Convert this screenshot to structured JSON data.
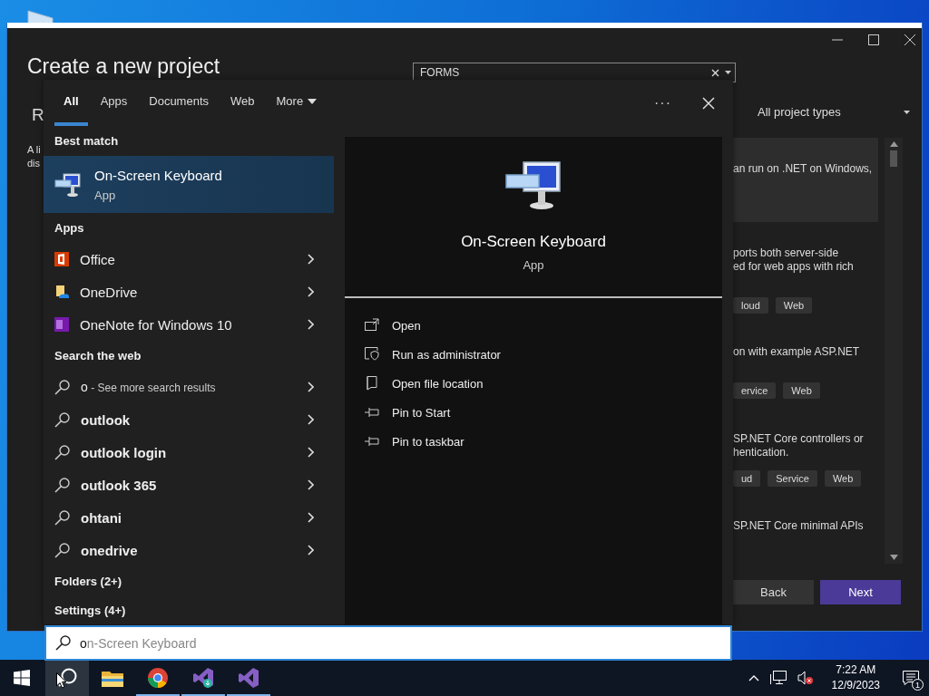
{
  "vs_window": {
    "title": "Create a new project",
    "search": {
      "value": "FORMS"
    },
    "recent_heading": "R",
    "description_lines": [
      "A li",
      "dis"
    ],
    "filter": "All project types",
    "templates": [
      {
        "selected": true,
        "lines": [
          "an run on .NET on Windows,"
        ]
      },
      {
        "selected": false,
        "lines": [
          "ports both server-side",
          "ed for web apps with rich"
        ],
        "tags": [
          "loud",
          "Web"
        ]
      },
      {
        "selected": false,
        "lines": [
          "on with example ASP.NET"
        ],
        "tags": [
          "ervice",
          "Web"
        ]
      },
      {
        "selected": false,
        "lines": [
          "SP.NET Core controllers or",
          "hentication."
        ],
        "tags": [
          "ud",
          "Service",
          "Web"
        ]
      },
      {
        "selected": false,
        "lines": [
          "SP.NET Core minimal APIs"
        ]
      }
    ],
    "buttons": [
      {
        "label": "Back",
        "kind": "secondary"
      },
      {
        "label": "Next",
        "kind": "primary"
      }
    ]
  },
  "search_panel": {
    "tabs": [
      {
        "label": "All",
        "selected": true,
        "dropdown": false
      },
      {
        "label": "Apps",
        "selected": false,
        "dropdown": false
      },
      {
        "label": "Documents",
        "selected": false,
        "dropdown": false
      },
      {
        "label": "Web",
        "selected": false,
        "dropdown": false
      },
      {
        "label": "More",
        "selected": false,
        "dropdown": true
      }
    ],
    "more_options": "···",
    "best_match": {
      "heading": "Best match",
      "title": "On-Screen Keyboard",
      "subtitle": "App",
      "selected": true
    },
    "apps": {
      "heading": "Apps",
      "items": [
        "Office",
        "OneDrive",
        "OneNote for Windows 10"
      ]
    },
    "web": {
      "heading": "Search the web",
      "items": [
        {
          "query": "o",
          "suffix": " - See more search results"
        },
        {
          "query": "outlook"
        },
        {
          "query": "outlook login"
        },
        {
          "query": "outlook 365"
        },
        {
          "query": "ohtani"
        },
        {
          "query": "onedrive"
        }
      ]
    },
    "groups": [
      "Folders (2+)",
      "Settings (4+)"
    ],
    "preview": {
      "title": "On-Screen Keyboard",
      "subtitle": "App",
      "actions": [
        "Open",
        "Run as administrator",
        "Open file location",
        "Pin to Start",
        "Pin to taskbar"
      ]
    },
    "search_box": {
      "value": "o",
      "completion": "n-Screen Keyboard"
    }
  },
  "taskbar": {
    "buttons": [
      {
        "selected": false,
        "running": false
      },
      {
        "selected": true,
        "running": false
      },
      {
        "selected": false,
        "running": false
      },
      {
        "selected": false,
        "running": true
      },
      {
        "selected": false,
        "running": true
      },
      {
        "selected": false,
        "running": true
      }
    ],
    "time": "7:22 AM",
    "date": "12/9/2023",
    "notification_count": "1"
  }
}
